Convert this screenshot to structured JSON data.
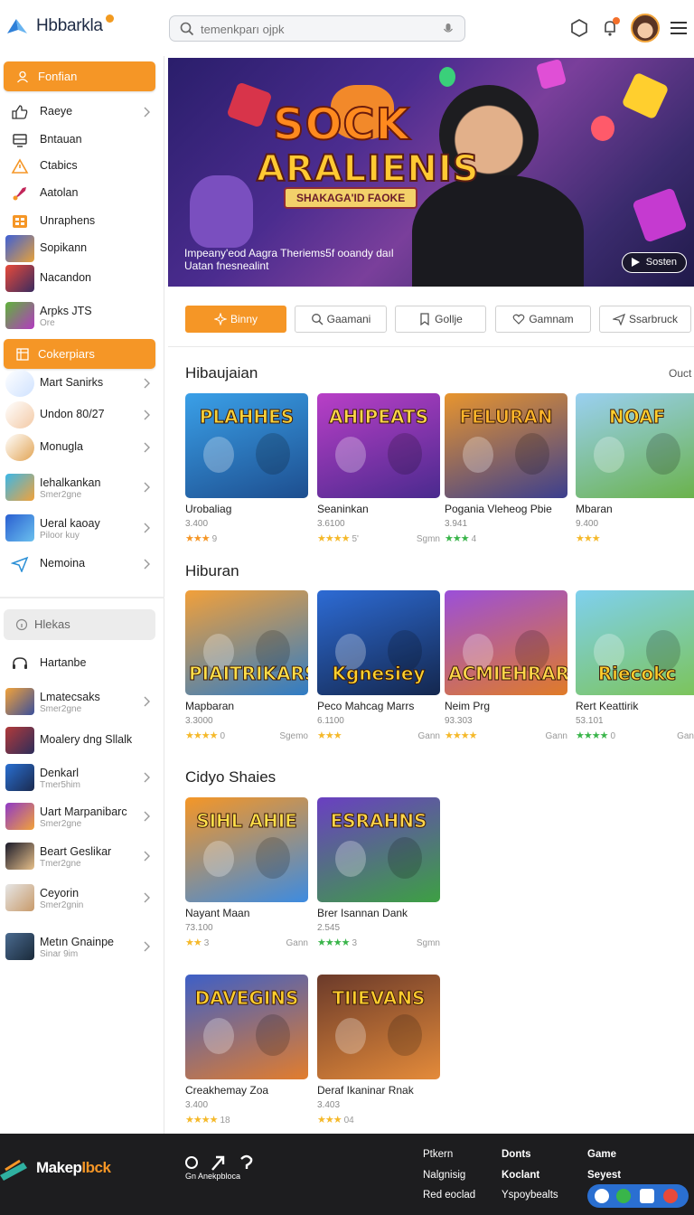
{
  "header": {
    "app_name": "Hbbarkla",
    "search_placeholder": "temenkparı ojpk"
  },
  "sidebar": {
    "primary_button": "Fonfian",
    "items_a": [
      {
        "label": "Raeye"
      },
      {
        "label": "Bntauan"
      },
      {
        "label": "Ctabics"
      },
      {
        "label": "Aatolan"
      },
      {
        "label": "Unraphens"
      },
      {
        "label": "Sopikann"
      },
      {
        "label": "Nacandon"
      },
      {
        "label": "Arpks JTS",
        "sub": "Ore"
      }
    ],
    "section_button": "Cokerpiars",
    "items_b": [
      {
        "label": "Mart Sanirks"
      },
      {
        "label": "Undon 80/27"
      },
      {
        "label": "Monugla"
      },
      {
        "label": "Iehalkankan",
        "sub": "Smer2gne"
      },
      {
        "label": "Ueral kaoay",
        "sub": "Piloor kuy"
      },
      {
        "label": "Nemoina"
      }
    ],
    "search_label": "Hlekas",
    "heading_item": "Hartanbe",
    "items_c": [
      {
        "label": "Lmatecsaks",
        "sub": "Smer2gne"
      },
      {
        "label": "Moalery dng Sllalk"
      },
      {
        "label": "Denkarl",
        "sub": "Tmer5him"
      },
      {
        "label": "Uart Marpanibarc",
        "sub": "Smer2gne"
      },
      {
        "label": "Beart Geslikar",
        "sub": "Tmer2gne"
      },
      {
        "label": "Ceyorin",
        "sub": "Smer2gnin"
      },
      {
        "label": "Metın Gnainpe",
        "sub": "Sinar 9im"
      }
    ]
  },
  "hero": {
    "title_line1": "SOCK",
    "title_line2": "ARALIENIS",
    "ribbon": "SHAKAGA'ID FAOKE",
    "description_line1": "Impeany'eod Aagra Theriems5f ooandy daıl",
    "description_line2": "Uatan fnesnealint",
    "cta": "Sosten"
  },
  "tabs": [
    {
      "label": "Binny",
      "active": true
    },
    {
      "label": "Gaamani",
      "active": false
    },
    {
      "label": "Gollje",
      "active": false
    },
    {
      "label": "Gamnam",
      "active": false
    },
    {
      "label": "Ssarbruck",
      "active": false
    }
  ],
  "sections": [
    {
      "title": "Hibaujaian",
      "more": "Ouct",
      "cards": [
        {
          "title": "Urobaliag",
          "count": "3.400",
          "stars": "★★★",
          "rating": "9",
          "genre": "",
          "art_caption": "PLAHHES",
          "colors": [
            "#3aa0e8",
            "#1d4e8f"
          ],
          "cap_color": "#f7d23b",
          "star_color": "#f59626"
        },
        {
          "title": "Seaninkan",
          "count": "3.6100",
          "stars": "★★★★",
          "rating": "5'",
          "genre": "Sgmn",
          "art_caption": "AHIPEATS",
          "colors": [
            "#b93fc7",
            "#4a2a8e"
          ],
          "cap_color": "#ffd64a",
          "star_color": "#f5b92a"
        },
        {
          "title": "Pogania Vleheog Pbie",
          "count": "3.941",
          "stars": "★★★",
          "rating": "4",
          "genre": "",
          "art_caption": "FELURAN",
          "colors": [
            "#e8952e",
            "#3c3f8e"
          ],
          "cap_color": "#ffb62b",
          "star_color": "#39b54a"
        },
        {
          "title": "Mbaran",
          "count": "9.400",
          "stars": "★★★",
          "rating": "",
          "genre": "",
          "art_caption": "NOAF",
          "colors": [
            "#9ad0f2",
            "#6ab24a"
          ],
          "cap_color": "#ffcf2e",
          "star_color": "#f5b92a"
        }
      ]
    },
    {
      "title": "Hiburan",
      "more": "",
      "cards": [
        {
          "title": "Mapbaran",
          "count": "3.3000",
          "stars": "★★★★",
          "rating": "0",
          "genre": "Sgemo",
          "art_caption": "PIAITRIKARS",
          "colors": [
            "#f2a03a",
            "#2f7cc5"
          ],
          "cap_color": "#ffe04a",
          "star_color": "#f5b92a"
        },
        {
          "title": "Peco Mahcag Marrs",
          "count": "6.1100",
          "stars": "★★★",
          "rating": "",
          "genre": "Gann",
          "art_caption": "Kgnesiey",
          "colors": [
            "#2d6bd4",
            "#14274e"
          ],
          "cap_color": "#ffd22e",
          "star_color": "#f5b92a"
        },
        {
          "title": "Neim Prg",
          "count": "93.303",
          "stars": "★★★★",
          "rating": "",
          "genre": "Gann",
          "art_caption": "ACMIEHRAR",
          "colors": [
            "#9b4fd9",
            "#e07b28"
          ],
          "cap_color": "#ffd64a",
          "star_color": "#f5b92a"
        },
        {
          "title": "Rert Keattirik",
          "count": "53.101",
          "stars": "★★★★",
          "rating": "0",
          "genre": "Gan",
          "art_caption": "Riecokc",
          "colors": [
            "#7fd0ee",
            "#7cc45a"
          ],
          "cap_color": "#ffcf2e",
          "star_color": "#39b54a"
        }
      ]
    },
    {
      "title": "Cidyo Shaies",
      "more": "",
      "cards": [
        {
          "title": "Nayant Maan",
          "count": "73.100",
          "stars": "★★",
          "rating": "3",
          "genre": "Gann",
          "art_caption": "SIHL AHIE",
          "colors": [
            "#f59626",
            "#3d8be0"
          ],
          "cap_color": "#ffe04a",
          "star_color": "#f5b92a"
        },
        {
          "title": "Brer Isannan Dank",
          "count": "2.545",
          "stars": "★★★★",
          "rating": "3",
          "genre": "Sgmn",
          "art_caption": "ESRAHNS",
          "colors": [
            "#6a3fc2",
            "#3da043"
          ],
          "cap_color": "#ffd64a",
          "star_color": "#39b54a"
        },
        {
          "title": "Creakhemay Zoa",
          "count": "3.400",
          "stars": "★★★★",
          "rating": "18",
          "genre": "",
          "art_caption": "DAVEGINS",
          "colors": [
            "#3d5fc7",
            "#e27d2d"
          ],
          "cap_color": "#ffcf2e",
          "star_color": "#f5b92a"
        },
        {
          "title": "Deraf Ikaninar Rnak",
          "count": "3.403",
          "stars": "★★★",
          "rating": "04",
          "genre": "",
          "art_caption": "TIIEVANS",
          "colors": [
            "#6b3a2a",
            "#e48b3a"
          ],
          "cap_color": "#ffcf2e",
          "star_color": "#f5b92a"
        }
      ]
    }
  ],
  "footer": {
    "brand_a": "Makep",
    "brand_b": "lbck",
    "tools_label": "Gn   Anekpbloca",
    "col1": [
      "Ptkern",
      "Nalgnisig",
      "Red eoclad"
    ],
    "col2": [
      "Donts",
      "Koclant",
      "Yspoybealts"
    ],
    "col3": [
      "Game",
      "Seyest"
    ]
  },
  "colors": {
    "accent": "#f59626",
    "footer_bg": "#1d1d1f"
  }
}
